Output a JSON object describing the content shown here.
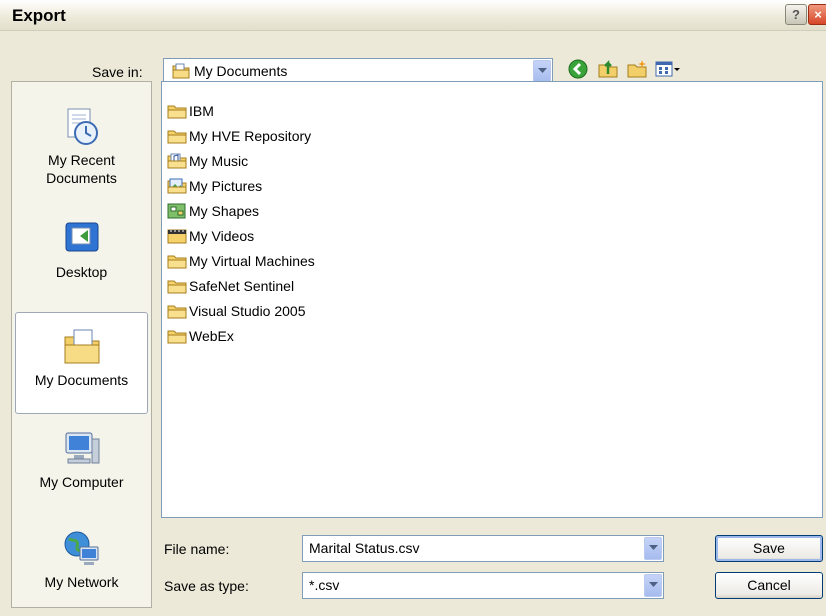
{
  "window": {
    "title": "Export",
    "help_label": "?",
    "close_label": "×"
  },
  "save_in": {
    "label": "Save in:",
    "value": "My Documents"
  },
  "toolbar": [
    "back-icon",
    "up-folder-icon",
    "new-folder-icon",
    "view-menu-icon"
  ],
  "places": [
    {
      "label_line1": "My Recent",
      "label_line2": "Documents",
      "icon": "recent-documents-icon"
    },
    {
      "label_line1": "Desktop",
      "label_line2": "",
      "icon": "desktop-icon"
    },
    {
      "label_line1": "My Documents",
      "label_line2": "",
      "icon": "my-documents-icon",
      "selected": true
    },
    {
      "label_line1": "My Computer",
      "label_line2": "",
      "icon": "my-computer-icon"
    },
    {
      "label_line1": "My Network",
      "label_line2": "",
      "icon": "my-network-icon"
    }
  ],
  "files": [
    {
      "name": "IBM",
      "icon": "folder-icon"
    },
    {
      "name": "My HVE Repository",
      "icon": "folder-icon"
    },
    {
      "name": "My Music",
      "icon": "music-folder-icon"
    },
    {
      "name": "My Pictures",
      "icon": "pictures-folder-icon"
    },
    {
      "name": "My Shapes",
      "icon": "shapes-folder-icon"
    },
    {
      "name": "My Videos",
      "icon": "videos-folder-icon"
    },
    {
      "name": "My Virtual Machines",
      "icon": "folder-icon"
    },
    {
      "name": "SafeNet Sentinel",
      "icon": "folder-icon"
    },
    {
      "name": "Visual Studio 2005",
      "icon": "folder-icon"
    },
    {
      "name": "WebEx",
      "icon": "folder-icon"
    }
  ],
  "file_name": {
    "label": "File name:",
    "value": "Marital Status.csv"
  },
  "save_as_type": {
    "label": "Save as type:",
    "value": "*.csv"
  },
  "buttons": {
    "save": "Save",
    "cancel": "Cancel"
  },
  "colors": {
    "border_blue": "#7f9db9",
    "dialog_bg": "#ece9d8",
    "folder_yellow": "#f5d26a"
  }
}
